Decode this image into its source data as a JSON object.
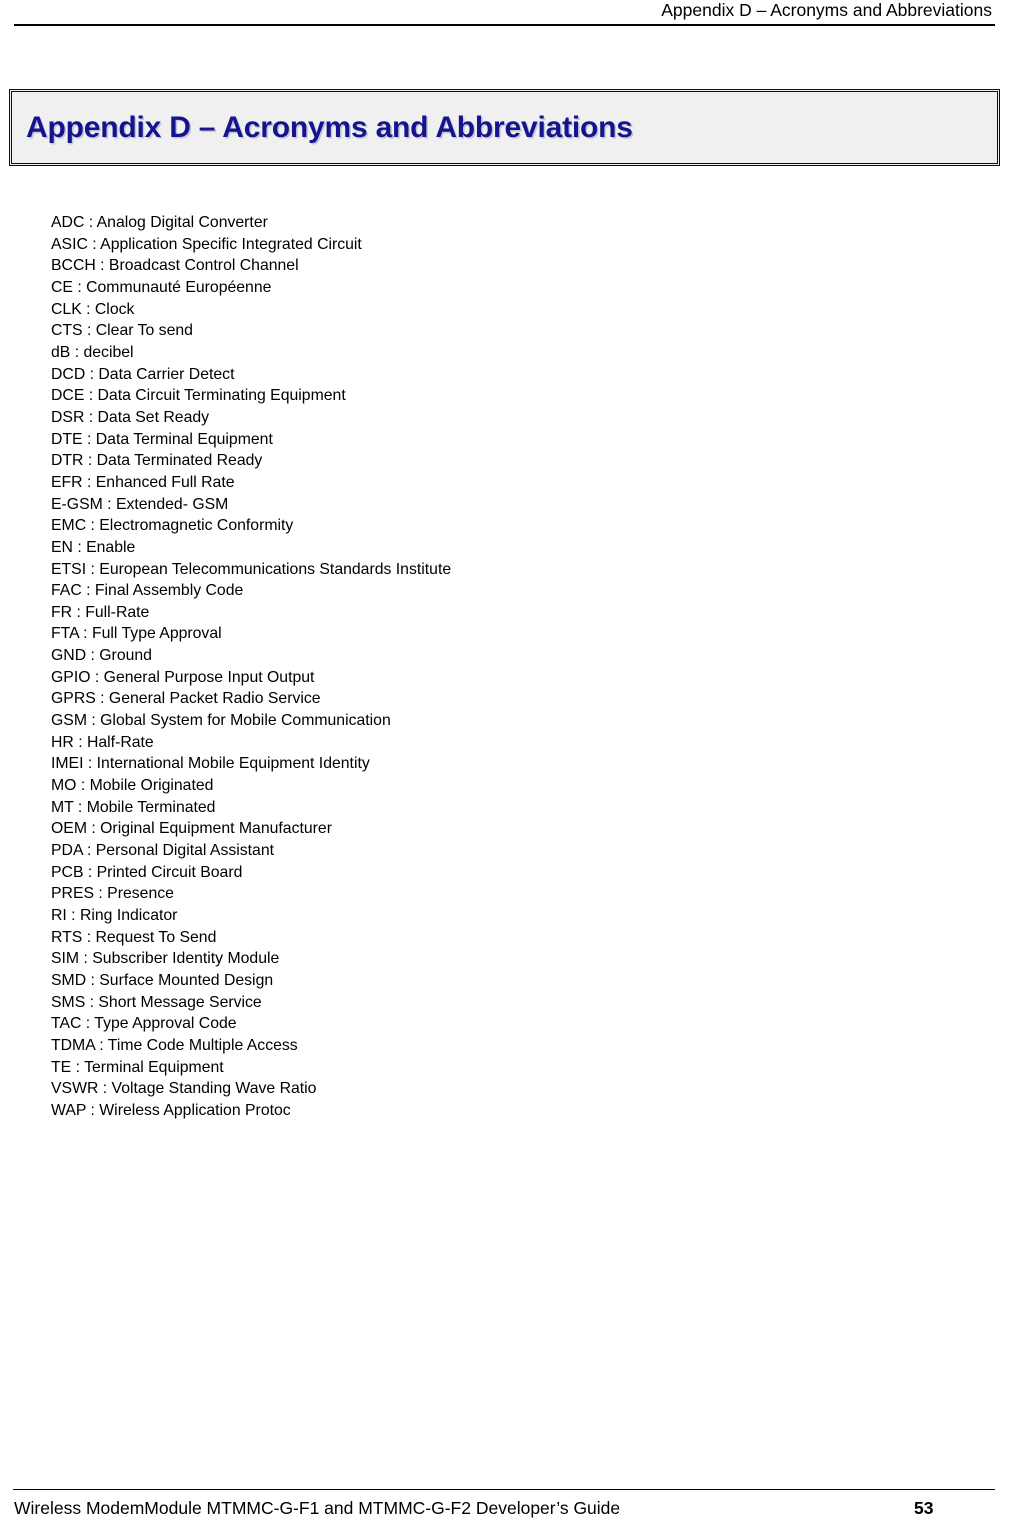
{
  "header": {
    "running_title": "Appendix D – Acronyms and Abbreviations"
  },
  "title_box": {
    "title": "Appendix D – Acronyms and Abbreviations",
    "border_color": "#000080",
    "background_color": "#f0f0f0",
    "text_color": "#14148c"
  },
  "acronyms": [
    "ADC : Analog Digital Converter",
    "ASIC : Application Specific Integrated Circuit",
    "BCCH : Broadcast Control Channel",
    "CE : Communauté Européenne",
    "CLK : Clock",
    "CTS : Clear To send",
    "dB : decibel",
    "DCD : Data Carrier Detect",
    "DCE : Data Circuit Terminating Equipment",
    "DSR : Data Set Ready",
    "DTE : Data Terminal Equipment",
    "DTR : Data Terminated Ready",
    "EFR : Enhanced Full Rate",
    "E-GSM : Extended- GSM",
    "EMC : Electromagnetic Conformity",
    "EN : Enable",
    "ETSI : European Telecommunications Standards Institute",
    "FAC : Final Assembly Code",
    "FR : Full-Rate",
    "FTA : Full Type Approval",
    "GND : Ground",
    "GPIO : General Purpose Input Output",
    "GPRS : General Packet Radio Service",
    "GSM : Global System for Mobile Communication",
    "HR : Half-Rate",
    "IMEI : International Mobile Equipment Identity",
    "MO : Mobile Originated",
    "MT : Mobile Terminated",
    "OEM : Original Equipment Manufacturer",
    "PDA : Personal Digital Assistant",
    "PCB : Printed Circuit Board",
    "PRES : Presence",
    "RI : Ring Indicator",
    "RTS : Request To Send",
    "SIM : Subscriber Identity Module",
    "SMD : Surface Mounted Design",
    "SMS : Short Message Service",
    "TAC : Type Approval Code",
    "TDMA : Time Code Multiple Access",
    "TE : Terminal Equipment",
    "VSWR : Voltage Standing Wave Ratio",
    "WAP : Wireless Application Protoc"
  ],
  "footer": {
    "document_title": "Wireless ModemModule MTMMC-G-F1 and MTMMC-G-F2 Developer’s Guide",
    "page_number": "53"
  }
}
